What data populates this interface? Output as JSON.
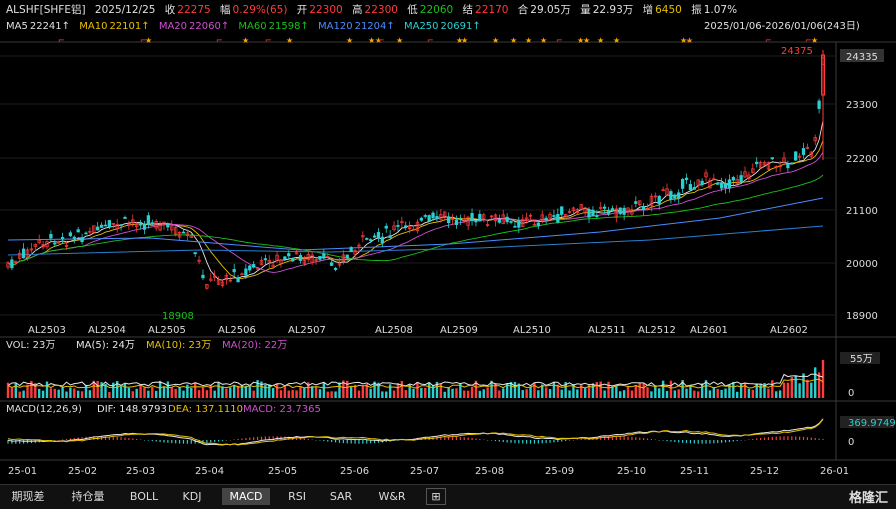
{
  "header": {
    "symbol": "ALSHF[SHFE铝]",
    "date": "2025/12/25",
    "close_label": "收",
    "close_value": "22275",
    "change_label": "幅",
    "change_value": "0.29%(65)",
    "open_label": "开",
    "open_value": "22300",
    "high_label": "高",
    "high_value": "22300",
    "low_label": "低",
    "low_value": "22060",
    "settle_label": "结",
    "settle_value": "22170",
    "oi_label": "合",
    "oi_value": "29.05万",
    "vol_label": "量",
    "vol_value": "22.93万",
    "diff_label": "增",
    "diff_value": "6450",
    "amp_label": "振",
    "amp_value": "1.07%"
  },
  "ma_line": {
    "ma5": "MA5",
    "ma5_val": "22241↑",
    "ma10": "MA10",
    "ma10_val": "22101↑",
    "ma20": "MA20",
    "ma20_val": "22060↑",
    "ma60": "MA60",
    "ma60_val": "21598↑",
    "ma120": "MA120",
    "ma120_val": "21204↑",
    "ma250": "MA250",
    "ma250_val": "20691↑",
    "range": "2025/01/06-2026/01/06(243日)"
  },
  "price_axis": [
    "24335",
    "23300",
    "22200",
    "21100",
    "20000",
    "18900"
  ],
  "price_current": "24335",
  "annotations": {
    "high": "24375",
    "low": "18908"
  },
  "contract_labels": [
    "AL2503",
    "AL2504",
    "AL2505",
    "AL2506",
    "AL2507",
    "AL2508",
    "AL2509",
    "AL2510",
    "AL2511",
    "AL2512",
    "AL2601",
    "AL2602"
  ],
  "vol_header": {
    "vol": "VOL: 23万",
    "ma5": "MA(5): 24万",
    "ma10": "MA(10): 23万",
    "ma20": "MA(20): 22万"
  },
  "vol_axis": {
    "top": "55万",
    "zero": "0"
  },
  "macd_header": {
    "macd_title": "MACD(12,26,9)",
    "dif": "DIF: 148.9793",
    "dea": "DEA: 137.1110",
    "macd": "MACD: 23.7365"
  },
  "macd_axis": {
    "top": "369.9749",
    "zero": "0"
  },
  "months": [
    "25-01",
    "25-02",
    "25-03",
    "25-04",
    "25-05",
    "25-06",
    "25-07",
    "25-08",
    "25-09",
    "25-10",
    "25-11",
    "25-12",
    "26-01"
  ],
  "tabs": [
    "期现差",
    "持仓量",
    "BOLL",
    "KDJ",
    "MACD",
    "RSI",
    "SAR",
    "W&R"
  ],
  "active_tab": "MACD",
  "add_tab": "⊞",
  "brand": "格隆汇",
  "colors": {
    "up": "#ff3b3b",
    "down": "#2ad0d0",
    "ma5": "#e6e6e6",
    "ma10": "#e6c000",
    "ma20": "#d050d0",
    "ma60": "#19c219",
    "ma120": "#4a8cff",
    "ma250": "#2a7fd0"
  }
}
